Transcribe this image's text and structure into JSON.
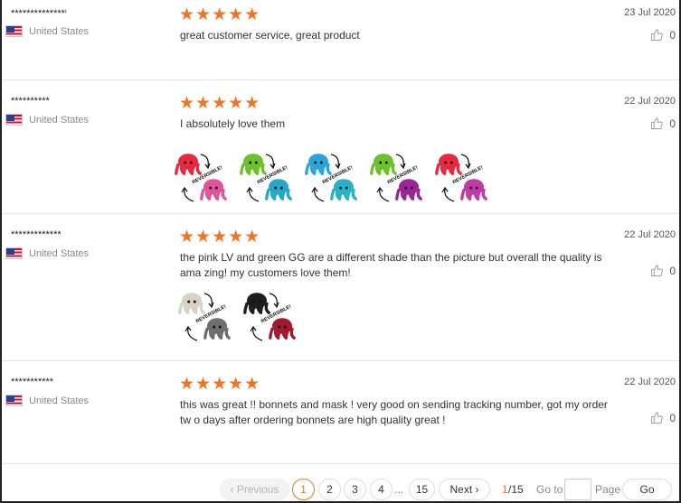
{
  "reviews": [
    {
      "user": "**************ⁱ",
      "country": "United States",
      "stars": "★★★★★",
      "date": "23 Jul 2020",
      "text": "great customer service, great product",
      "likes": "0",
      "photos": []
    },
    {
      "user": "**********",
      "country": "United States",
      "stars": "★★★★★",
      "date": "22 Jul 2020",
      "text": "I absolutely love them",
      "likes": "0",
      "photos": [
        {
          "top": "#e8283c",
          "bottom": "#e0559a",
          "label": "REVERSIBLE!"
        },
        {
          "top": "#6cc22c",
          "bottom": "#24a7c9",
          "label": "REVERSIBLE!"
        },
        {
          "top": "#2aa5da",
          "bottom": "#2ab1c9",
          "label": "REVERSIBLE!"
        },
        {
          "top": "#6cc22c",
          "bottom": "#9b2595",
          "label": "REVERSIBLE!"
        },
        {
          "top": "#e8283c",
          "bottom": "#bf3aa6",
          "label": "REVERSIBLE!"
        }
      ]
    },
    {
      "user": "*************",
      "country": "United States",
      "stars": "★★★★★",
      "date": "22 Jul 2020",
      "text": "the pink LV and green GG are a different shade than the picture but overall the quality is ama zing! my customers love them!",
      "likes": "0",
      "photos": [
        {
          "top": "#d6d2c4",
          "bottom": "#6e6e6e",
          "label": "REVERSIBLE!"
        },
        {
          "top": "#1d1d1d",
          "bottom": "#a3192e",
          "label": "REVERSIBLE!"
        }
      ]
    },
    {
      "user": "***********",
      "country": "United States",
      "stars": "★★★★★",
      "date": "22 Jul 2020",
      "text": "this was great !! bonnets and mask ! very good on sending tracking number, got my order tw o days after ordering bonnets are high quality great !",
      "likes": "0",
      "photos": []
    }
  ],
  "pagination": {
    "previous": "‹ Previous",
    "pages": [
      "1",
      "2",
      "3",
      "4"
    ],
    "ellipsis": "...",
    "last": "15",
    "next": "Next ›",
    "current": "1",
    "total": "/15",
    "goto_label": "Go to",
    "page_label": "Page",
    "go": "Go"
  }
}
